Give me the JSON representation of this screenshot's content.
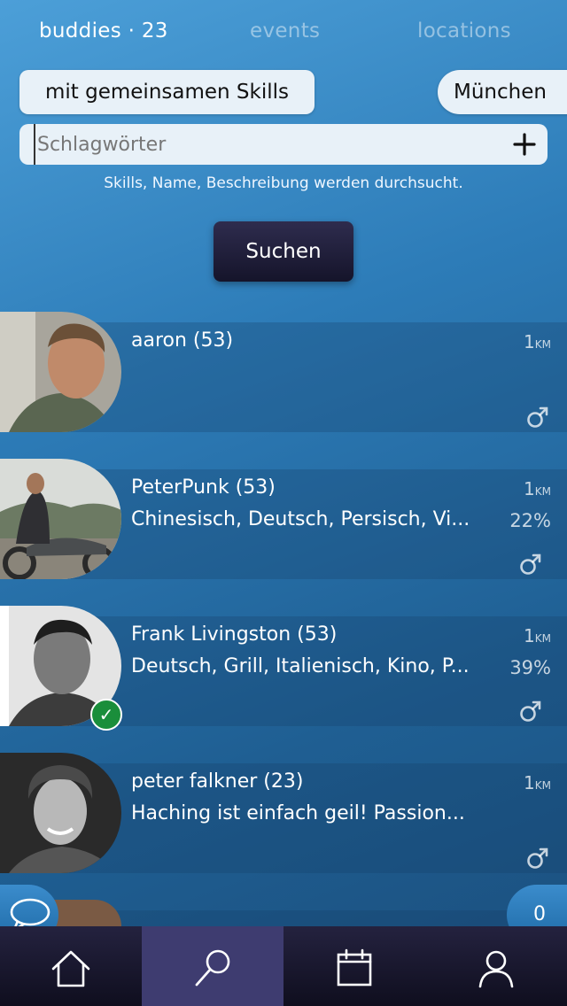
{
  "tabs": {
    "buddies": "buddies · 23",
    "events": "events",
    "locations": "locations"
  },
  "filters": {
    "skills_label": "mit gemeinsamen Skills",
    "city_label": "München"
  },
  "search": {
    "placeholder": "Schlagwörter",
    "hint": "Skills, Name, Beschreibung werden durchsucht.",
    "button_label": "Suchen"
  },
  "users": [
    {
      "name": "aaron (53)",
      "description": "",
      "distance": "1",
      "distance_unit": "KM",
      "match": "",
      "gender_icon": "male-icon",
      "verified": false
    },
    {
      "name": "PeterPunk (53)",
      "description": "Chinesisch, Deutsch, Persisch, Vi...",
      "distance": "1",
      "distance_unit": "KM",
      "match": "22%",
      "gender_icon": "male-icon",
      "verified": false
    },
    {
      "name": "Frank Livingston (53)",
      "description": "Deutsch, Grill, Italienisch, Kino, P...",
      "distance": "1",
      "distance_unit": "KM",
      "match": "39%",
      "gender_icon": "male-icon",
      "verified": true
    },
    {
      "name": "peter falkner (23)",
      "description": "Haching ist einfach geil! Passion...",
      "distance": "1",
      "distance_unit": "KM",
      "match": "",
      "gender_icon": "male-icon",
      "verified": false
    }
  ],
  "floating": {
    "message_count": "0"
  },
  "nav": {
    "items": [
      "home-icon",
      "search-icon",
      "calendar-icon",
      "profile-icon"
    ],
    "active": "search-icon"
  },
  "colors": {
    "background_top": "#4c9fd8",
    "background_bottom": "#1b4e7c",
    "button_dark": "#15142a",
    "nav_active": "#3e3c70",
    "verified_green": "#1a8e3b"
  }
}
